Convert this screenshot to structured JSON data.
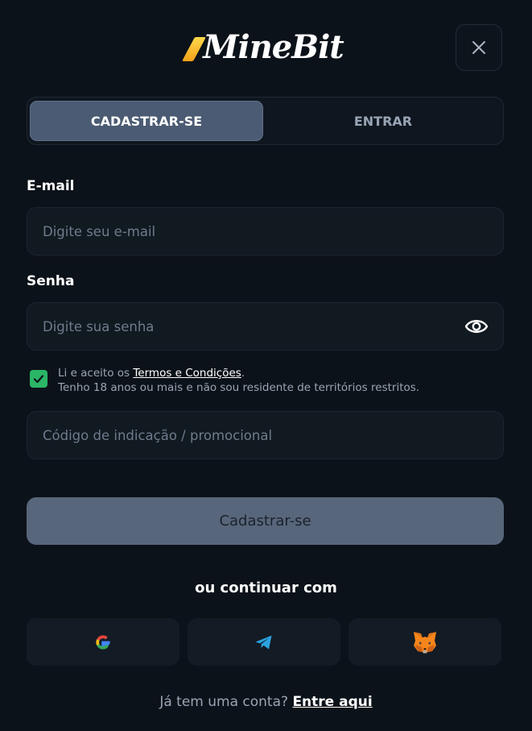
{
  "brand": {
    "logo_text": "MineBit"
  },
  "tabs": [
    {
      "label": "CADASTRAR-SE",
      "active": true
    },
    {
      "label": "ENTRAR",
      "active": false
    }
  ],
  "form": {
    "email": {
      "label": "E-mail",
      "placeholder": "Digite seu e-mail",
      "value": ""
    },
    "password": {
      "label": "Senha",
      "placeholder": "Digite sua senha",
      "value": "",
      "toggle_icon": "eye-icon"
    },
    "terms": {
      "checked": true,
      "prefix": "Li e aceito os ",
      "link": "Termos e Condições",
      "suffix": ".",
      "line2": "Tenho 18 anos ou mais e não sou residente de territórios restritos."
    },
    "promo": {
      "placeholder": "Código de indicação / promocional",
      "value": ""
    },
    "submit_label": "Cadastrar-se"
  },
  "social": {
    "heading": "ou continuar com",
    "providers": [
      "google-icon",
      "telegram-icon",
      "metamask-icon"
    ]
  },
  "footer": {
    "question": "Já tem uma conta?",
    "link": "Entre aqui"
  },
  "colors": {
    "background": "#0c1219",
    "active_tab": "#4b5b73",
    "submit_button": "#58667b",
    "checkbox": "#2bb566",
    "logo_accent": "#f2a31a"
  }
}
